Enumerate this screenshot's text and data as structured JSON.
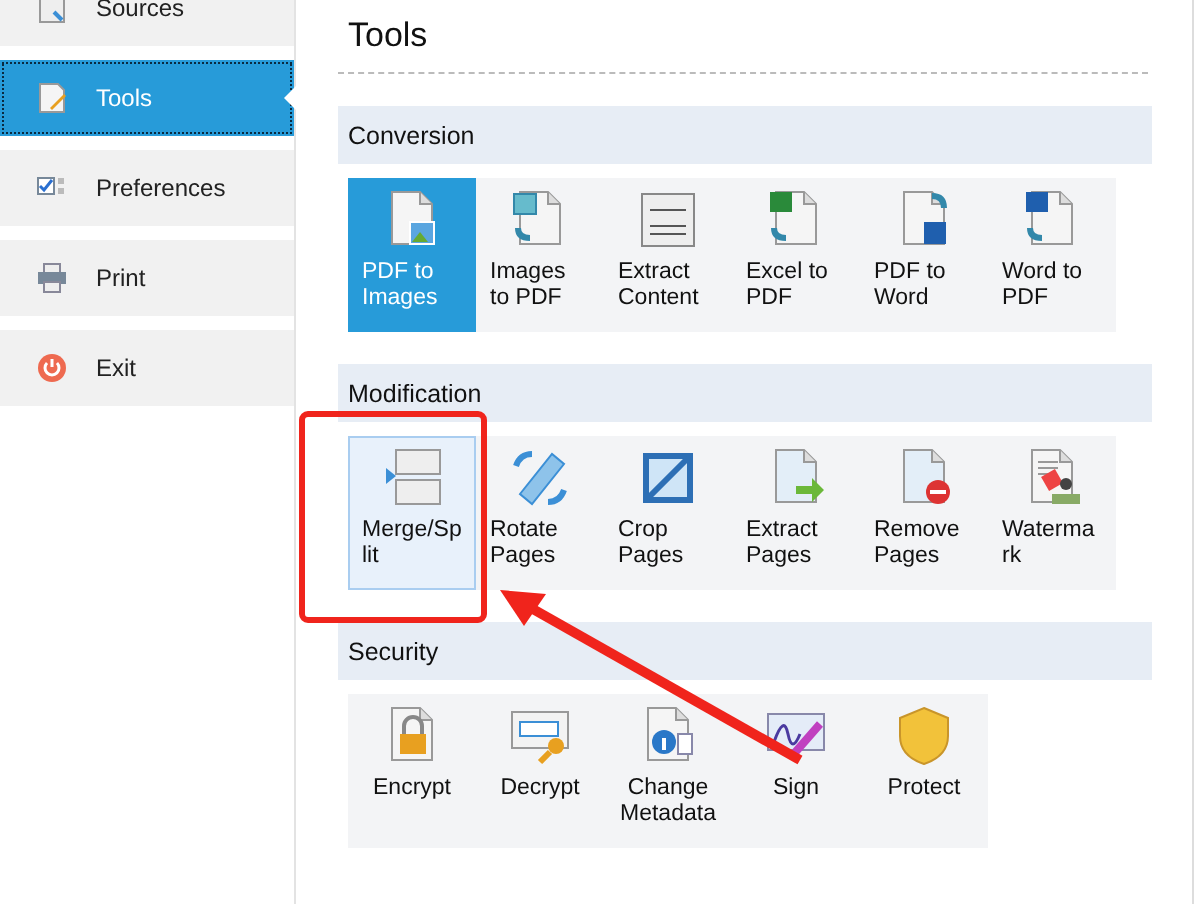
{
  "sidebar": {
    "items": [
      {
        "label": "Sources",
        "selected": false
      },
      {
        "label": "Tools",
        "selected": true
      },
      {
        "label": "Preferences",
        "selected": false
      },
      {
        "label": "Print",
        "selected": false
      },
      {
        "label": "Exit",
        "selected": false
      }
    ]
  },
  "page_title": "Tools",
  "sections": [
    {
      "title": "Conversion",
      "tools": [
        {
          "label": "PDF to Images",
          "selected": true,
          "hovered": false
        },
        {
          "label": "Images to PDF",
          "selected": false,
          "hovered": false
        },
        {
          "label": "Extract Content",
          "selected": false,
          "hovered": false
        },
        {
          "label": "Excel to PDF",
          "selected": false,
          "hovered": false
        },
        {
          "label": "PDF to Word",
          "selected": false,
          "hovered": false
        },
        {
          "label": "Word to PDF",
          "selected": false,
          "hovered": false
        }
      ]
    },
    {
      "title": "Modification",
      "tools": [
        {
          "label": "Merge/Split",
          "selected": false,
          "hovered": true
        },
        {
          "label": "Rotate Pages",
          "selected": false,
          "hovered": false
        },
        {
          "label": "Crop Pages",
          "selected": false,
          "hovered": false
        },
        {
          "label": "Extract Pages",
          "selected": false,
          "hovered": false
        },
        {
          "label": "Remove Pages",
          "selected": false,
          "hovered": false
        },
        {
          "label": "Watermark",
          "selected": false,
          "hovered": false
        }
      ]
    },
    {
      "title": "Security",
      "tools": [
        {
          "label": "Encrypt",
          "selected": false,
          "hovered": false
        },
        {
          "label": "Decrypt",
          "selected": false,
          "hovered": false
        },
        {
          "label": "Change Metadata",
          "selected": false,
          "hovered": false
        },
        {
          "label": "Sign",
          "selected": false,
          "hovered": false
        },
        {
          "label": "Protect",
          "selected": false,
          "hovered": false
        }
      ]
    }
  ]
}
